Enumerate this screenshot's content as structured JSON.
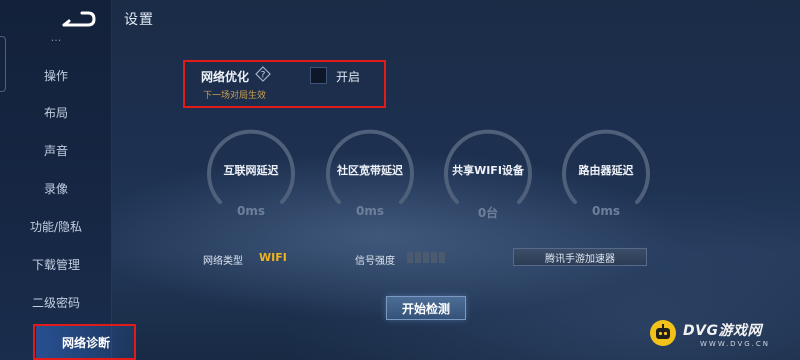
{
  "page": {
    "title": "设置"
  },
  "sidebar": {
    "partial_item": "...",
    "items": [
      {
        "label": "操作"
      },
      {
        "label": "布局"
      },
      {
        "label": "声音"
      },
      {
        "label": "录像"
      },
      {
        "label": "功能/隐私"
      },
      {
        "label": "下载管理"
      },
      {
        "label": "二级密码"
      },
      {
        "label": "网络诊断",
        "active": true
      }
    ]
  },
  "network_opt": {
    "title": "网络优化",
    "subtitle": "下一场对局生效",
    "toggle_label": "开启",
    "toggle_on": false,
    "help_icon": "question-diamond-icon"
  },
  "gauges": [
    {
      "label": "互联网延迟",
      "value": "0ms"
    },
    {
      "label": "社区宽带延迟",
      "value": "0ms"
    },
    {
      "label": "共享WIFI设备",
      "value": "0台"
    },
    {
      "label": "路由器延迟",
      "value": "0ms"
    }
  ],
  "info": {
    "net_type_label": "网络类型",
    "net_type_value": "WIFI",
    "signal_label": "信号强度",
    "signal_bars_filled": 0,
    "accelerator_button": "腾讯手游加速器"
  },
  "start_button": "开始检测",
  "watermark": {
    "text": "DVG游戏网",
    "sub": "WWW.DVG.CN"
  },
  "colors": {
    "accent_yellow": "#f0b21e",
    "highlight_red": "#e11a1a",
    "active_blue": "#2d5faf"
  }
}
